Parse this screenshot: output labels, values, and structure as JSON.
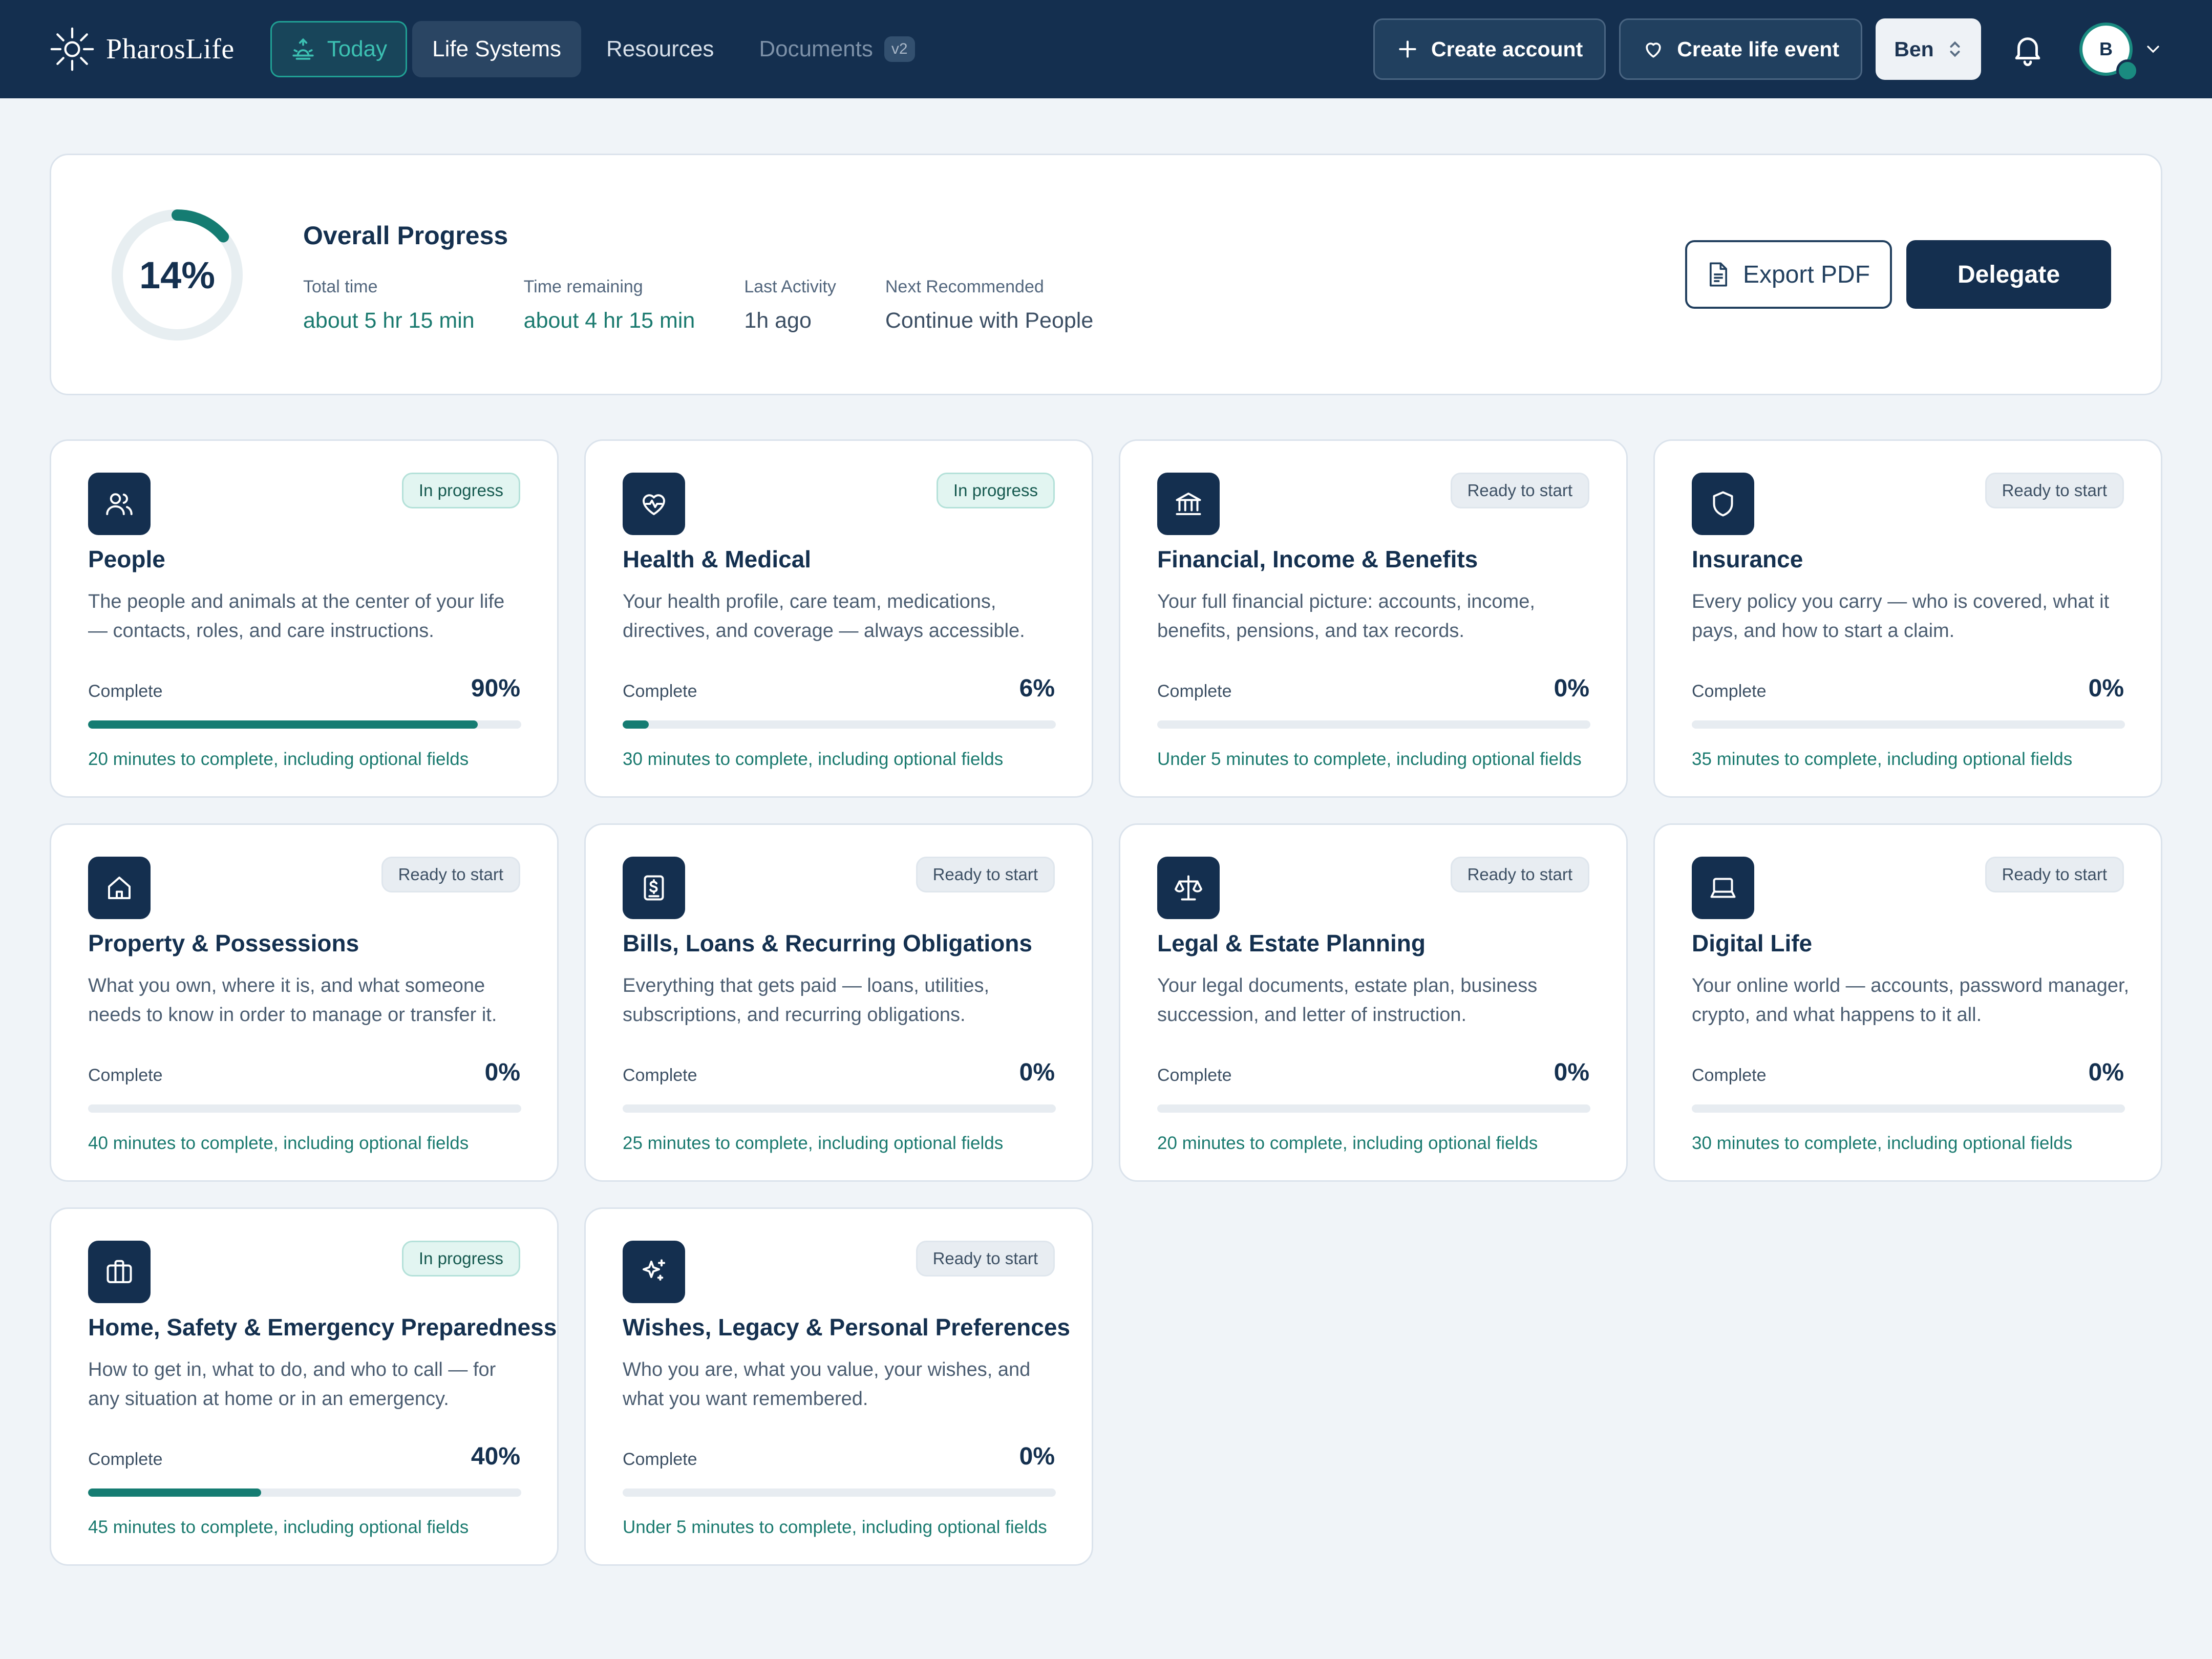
{
  "brand": {
    "name": "PharosLife"
  },
  "nav": {
    "today": "Today",
    "life_systems": "Life Systems",
    "resources": "Resources",
    "documents": "Documents",
    "documents_badge": "v2"
  },
  "header_actions": {
    "create_account": "Create account",
    "create_life_event": "Create life event",
    "user_select": "Ben",
    "avatar_initial": "B"
  },
  "overall": {
    "percent_label": "14%",
    "percent_value": 14,
    "title": "Overall Progress",
    "stats": [
      {
        "label": "Total time",
        "value": "about 5 hr 15 min"
      },
      {
        "label": "Time remaining",
        "value": "about 4 hr 15 min"
      },
      {
        "label": "Last Activity",
        "value": "1h ago"
      },
      {
        "label": "Next Recommended",
        "value": "Continue with People"
      }
    ],
    "export_label": "Export PDF",
    "delegate_label": "Delegate"
  },
  "complete_label": "Complete",
  "cards": [
    {
      "icon": "people-icon",
      "title": "People",
      "status": "In progress",
      "description": "The people and animals at the center of your life — contacts, roles, and care instructions.",
      "percent_label": "90%",
      "percent": 90,
      "time": "20 minutes to complete, including optional fields"
    },
    {
      "icon": "heart-pulse-icon",
      "title": "Health & Medical",
      "status": "In progress",
      "description": "Your health profile, care team, medications, directives, and coverage — always accessible.",
      "percent_label": "6%",
      "percent": 6,
      "time": "30 minutes to complete, including optional fields"
    },
    {
      "icon": "bank-icon",
      "title": "Financial, Income & Benefits",
      "status": "Ready to start",
      "description": "Your full financial picture: accounts, income, benefits, pensions, and tax records.",
      "percent_label": "0%",
      "percent": 0,
      "time": "Under 5 minutes to complete, including optional fields"
    },
    {
      "icon": "shield-icon",
      "title": "Insurance",
      "status": "Ready to start",
      "description": "Every policy you carry — who is covered, what it pays, and how to start a claim.",
      "percent_label": "0%",
      "percent": 0,
      "time": "35 minutes to complete, including optional fields"
    },
    {
      "icon": "house-icon",
      "title": "Property & Possessions",
      "status": "Ready to start",
      "description": "What you own, where it is, and what someone needs to know in order to manage or transfer it.",
      "percent_label": "0%",
      "percent": 0,
      "time": "40 minutes to complete, including optional fields"
    },
    {
      "icon": "receipt-icon",
      "title": "Bills, Loans & Recurring Obligations",
      "status": "Ready to start",
      "description": "Everything that gets paid — loans, utilities, subscriptions, and recurring obligations.",
      "percent_label": "0%",
      "percent": 0,
      "time": "25 minutes to complete, including optional fields"
    },
    {
      "icon": "scales-icon",
      "title": "Legal & Estate Planning",
      "status": "Ready to start",
      "description": "Your legal documents, estate plan, business succession, and letter of instruction.",
      "percent_label": "0%",
      "percent": 0,
      "time": "20 minutes to complete, including optional fields"
    },
    {
      "icon": "laptop-icon",
      "title": "Digital Life",
      "status": "Ready to start",
      "description": "Your online world — accounts, password manager, crypto, and what happens to it all.",
      "percent_label": "0%",
      "percent": 0,
      "time": "30 minutes to complete, including optional fields"
    },
    {
      "icon": "briefcase-icon",
      "title": "Home, Safety & Emergency Preparedness",
      "status": "In progress",
      "description": "How to get in, what to do, and who to call — for any situation at home or in an emergency.",
      "percent_label": "40%",
      "percent": 40,
      "time": "45 minutes to complete, including optional fields"
    },
    {
      "icon": "sparkle-icon",
      "title": "Wishes, Legacy & Personal Preferences",
      "status": "Ready to start",
      "description": "Who you are, what you value, your wishes, and what you want remembered.",
      "percent_label": "0%",
      "percent": 0,
      "time": "Under 5 minutes to complete, including optional fields"
    }
  ],
  "colors": {
    "navy": "#142f4f",
    "teal": "#157c72",
    "background": "#f0f4f8"
  }
}
